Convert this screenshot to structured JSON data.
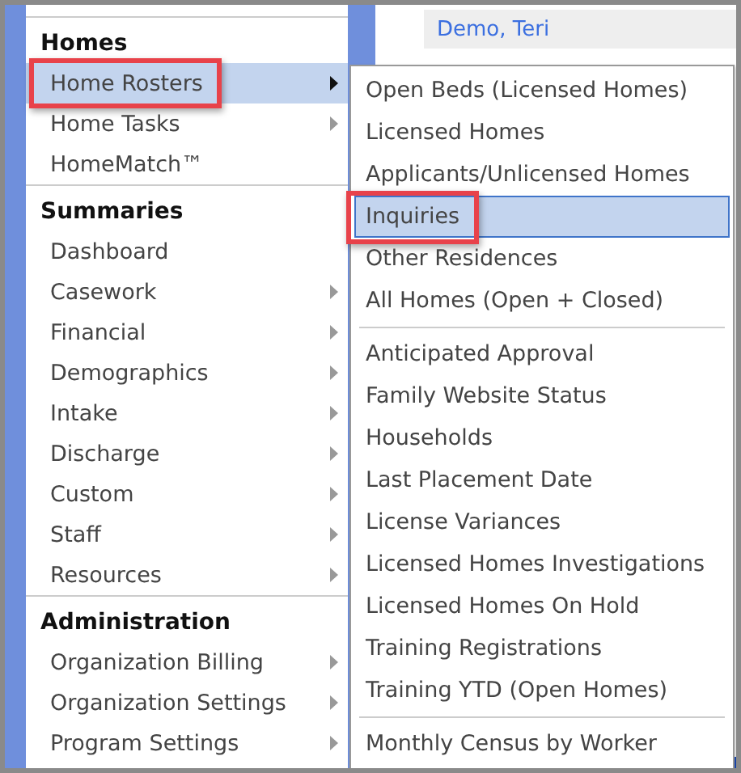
{
  "content": {
    "link": "Demo, Teri"
  },
  "menu": {
    "sections": [
      {
        "title": "Homes",
        "items": [
          {
            "label": "Home Rosters",
            "has_submenu": true,
            "selected": true,
            "callout": true
          },
          {
            "label": "Home Tasks",
            "has_submenu": true,
            "selected": false,
            "callout": false
          },
          {
            "label": "HomeMatch™",
            "has_submenu": false,
            "selected": false,
            "callout": false
          }
        ]
      },
      {
        "title": "Summaries",
        "items": [
          {
            "label": "Dashboard",
            "has_submenu": false,
            "selected": false,
            "callout": false
          },
          {
            "label": "Casework",
            "has_submenu": true,
            "selected": false,
            "callout": false
          },
          {
            "label": "Financial",
            "has_submenu": true,
            "selected": false,
            "callout": false
          },
          {
            "label": "Demographics",
            "has_submenu": true,
            "selected": false,
            "callout": false
          },
          {
            "label": "Intake",
            "has_submenu": true,
            "selected": false,
            "callout": false
          },
          {
            "label": "Discharge",
            "has_submenu": true,
            "selected": false,
            "callout": false
          },
          {
            "label": "Custom",
            "has_submenu": true,
            "selected": false,
            "callout": false
          },
          {
            "label": "Staff",
            "has_submenu": true,
            "selected": false,
            "callout": false
          },
          {
            "label": "Resources",
            "has_submenu": true,
            "selected": false,
            "callout": false
          }
        ]
      },
      {
        "title": "Administration",
        "items": [
          {
            "label": "Organization Billing",
            "has_submenu": true,
            "selected": false,
            "callout": false
          },
          {
            "label": "Organization Settings",
            "has_submenu": true,
            "selected": false,
            "callout": false
          },
          {
            "label": "Program Settings",
            "has_submenu": true,
            "selected": false,
            "callout": false
          }
        ]
      }
    ]
  },
  "submenu": {
    "groups": [
      [
        {
          "label": "Open Beds (Licensed Homes)",
          "selected": false,
          "callout": false
        },
        {
          "label": "Licensed Homes",
          "selected": false,
          "callout": false
        },
        {
          "label": "Applicants/Unlicensed Homes",
          "selected": false,
          "callout": false
        },
        {
          "label": "Inquiries",
          "selected": true,
          "callout": true
        },
        {
          "label": "Other Residences",
          "selected": false,
          "callout": false
        },
        {
          "label": "All Homes (Open + Closed)",
          "selected": false,
          "callout": false
        }
      ],
      [
        {
          "label": "Anticipated Approval",
          "selected": false,
          "callout": false
        },
        {
          "label": "Family Website Status",
          "selected": false,
          "callout": false
        },
        {
          "label": "Households",
          "selected": false,
          "callout": false
        },
        {
          "label": "Last Placement Date",
          "selected": false,
          "callout": false
        },
        {
          "label": "License Variances",
          "selected": false,
          "callout": false
        },
        {
          "label": "Licensed Homes Investigations",
          "selected": false,
          "callout": false
        },
        {
          "label": "Licensed Homes On Hold",
          "selected": false,
          "callout": false
        },
        {
          "label": "Training Registrations",
          "selected": false,
          "callout": false
        },
        {
          "label": "Training YTD (Open Homes)",
          "selected": false,
          "callout": false
        }
      ],
      [
        {
          "label": "Monthly Census by Worker",
          "selected": false,
          "callout": false
        }
      ]
    ]
  }
}
